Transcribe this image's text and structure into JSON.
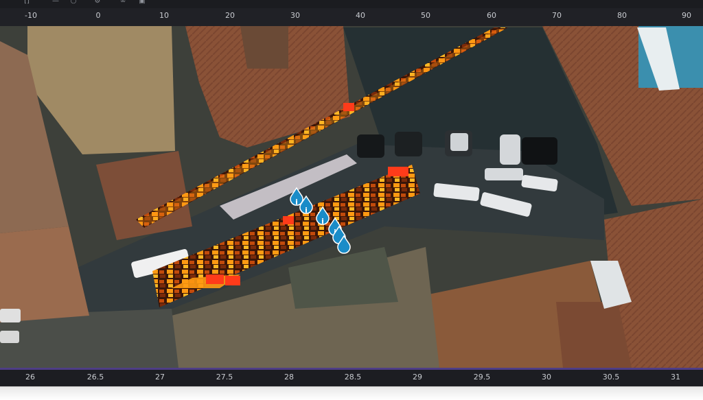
{
  "toolbar": {
    "icons": [
      "bracket-icon",
      "minus-icon",
      "circle-icon",
      "gear-icon",
      "link-icon",
      "image-icon"
    ]
  },
  "top_ruler": {
    "ticks": [
      "-10",
      "0",
      "10",
      "20",
      "30",
      "40",
      "50",
      "60",
      "70",
      "80",
      "90"
    ]
  },
  "bottom_ruler": {
    "ticks": [
      "26",
      "26.5",
      "27",
      "27.5",
      "28",
      "28.5",
      "29",
      "29.5",
      "30",
      "30.5",
      "31"
    ]
  },
  "map": {
    "markers": [
      {
        "name": "survey-marker-1",
        "icon": "info-pin-icon"
      },
      {
        "name": "survey-marker-2",
        "icon": "info-pin-icon"
      },
      {
        "name": "survey-marker-3",
        "icon": "info-pin-icon"
      },
      {
        "name": "survey-marker-4",
        "icon": "info-pin-icon"
      },
      {
        "name": "survey-marker-5",
        "icon": "info-pin-icon"
      },
      {
        "name": "survey-marker-6",
        "icon": "info-pin-icon"
      }
    ],
    "colors": {
      "heat_high": "#ff3b1a",
      "heat_mid": "#ff9a12",
      "heat_low": "#3a1608",
      "marker": "#1a8cc8"
    }
  }
}
